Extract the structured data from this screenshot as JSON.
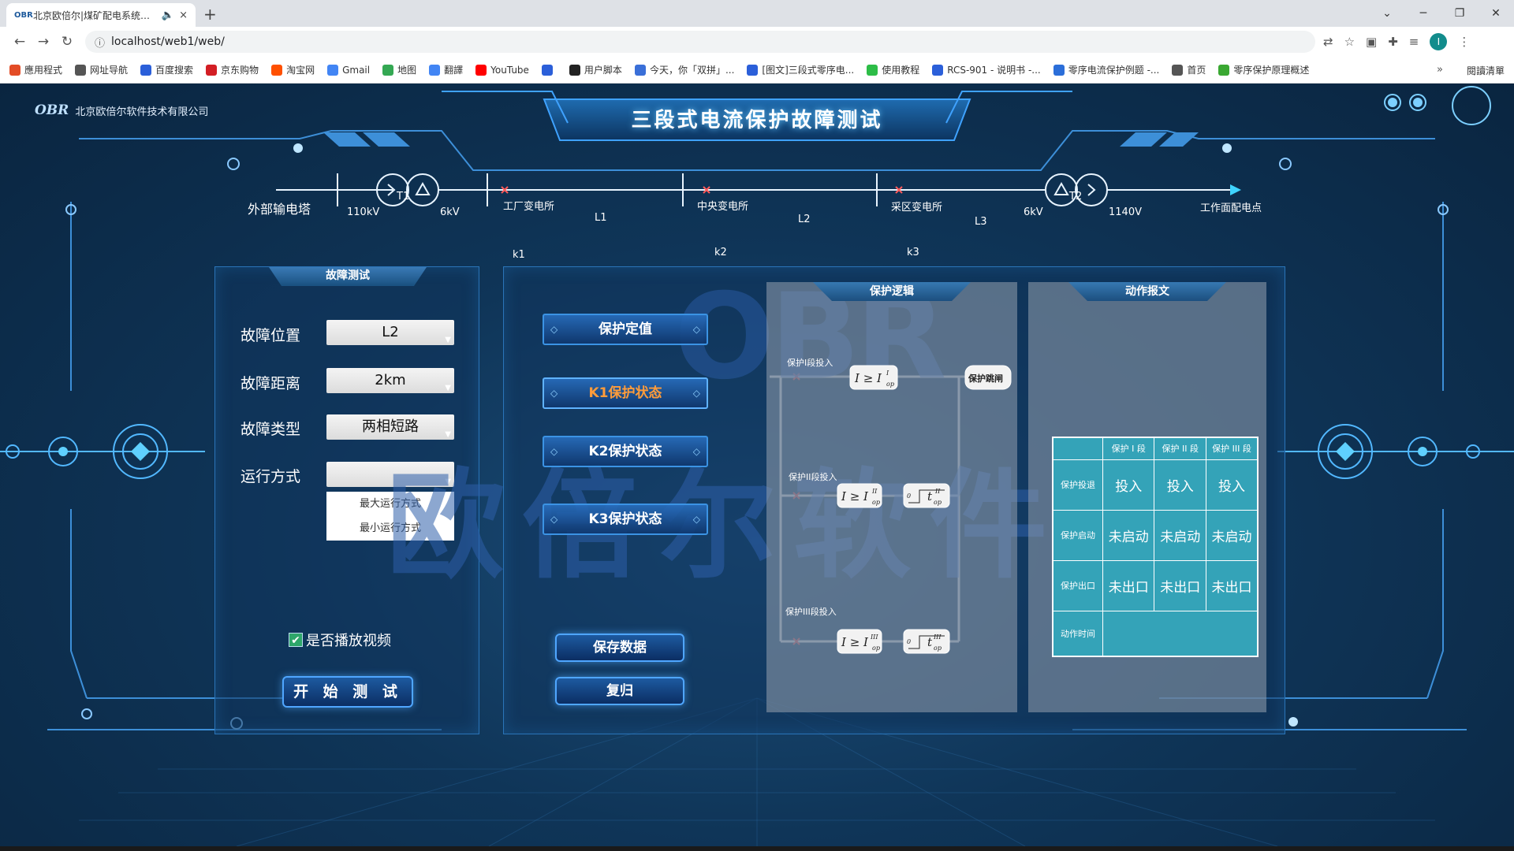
{
  "browser": {
    "tab_title": "北京欧倍尔|煤矿配电系统故障",
    "tab_fav": "OBR",
    "speaker_icon": "🔈",
    "close_tab": "×",
    "new_tab": "+",
    "url": "localhost/web1/web/",
    "bookmarks": [
      {
        "label": "應用程式",
        "color": "#e34c26"
      },
      {
        "label": "网址导航",
        "color": "#555555"
      },
      {
        "label": "百度搜索",
        "color": "#2b5fd9"
      },
      {
        "label": "京东购物",
        "color": "#d31e24"
      },
      {
        "label": "淘宝网",
        "color": "#ff5000"
      },
      {
        "label": "Gmail",
        "color": "#4285f4"
      },
      {
        "label": "地图",
        "color": "#34a853"
      },
      {
        "label": "翻譯",
        "color": "#4285f4"
      },
      {
        "label": "YouTube",
        "color": "#ff0000"
      },
      {
        "label": "",
        "color": "#2b5fd9"
      },
      {
        "label": "用户脚本",
        "color": "#222222"
      },
      {
        "label": "今天，你「双拼」...",
        "color": "#3a6fd8"
      },
      {
        "label": "[图文]三段式零序电...",
        "color": "#2b5fd9"
      },
      {
        "label": "使用教程",
        "color": "#2dbd47"
      },
      {
        "label": "RCS-901 - 说明书 -...",
        "color": "#2b5fd9"
      },
      {
        "label": "零序电流保护例题 -...",
        "color": "#2b6ed9"
      },
      {
        "label": "首页",
        "color": "#555555"
      },
      {
        "label": "零序保护原理概述",
        "color": "#3aa832"
      }
    ],
    "more": "»",
    "reading_list": "閱讀清單"
  },
  "app": {
    "logo_mark": "OBR",
    "company": "北京欧倍尔软件技术有限公司",
    "title": "三段式电流保护故障测试"
  },
  "diagram": {
    "source": "外部输电塔",
    "v110": "110kV",
    "t1": "T1",
    "v6a": "6kV",
    "factory": "工厂变电所",
    "l1": "L1",
    "k1": "k1",
    "central": "中央变电所",
    "l2": "L2",
    "k2": "k2",
    "mining": "采区变电所",
    "l3": "L3",
    "k3": "k3",
    "v6b": "6kV",
    "t2": "T2",
    "v1140": "1140V",
    "face": "工作面配电点"
  },
  "watermark": {
    "brand": "OBR",
    "cn": "欧倍尔软件"
  },
  "fault_panel": {
    "title": "故障测试",
    "location_label": "故障位置",
    "location_value": "L2",
    "distance_label": "故障距离",
    "distance_value": "2km",
    "type_label": "故障类型",
    "type_value": "两相短路",
    "mode_label": "运行方式",
    "mode_value": "",
    "mode_options": [
      "最大运行方式",
      "最小运行方式"
    ],
    "video_label": "是否播放视频",
    "video_checked": true,
    "start": "开 始 测 试"
  },
  "protection_buttons": {
    "setting": "保护定值",
    "k1": "K1保护状态",
    "k2": "K2保护状态",
    "k3": "K3保护状态",
    "save": "保存数据",
    "reset": "复归",
    "active_color": "#ff9c3a"
  },
  "logic": {
    "title": "保护逻辑",
    "stage1": "保护I段投入",
    "stage2": "保护II段投入",
    "stage3": "保护III段投入",
    "trip": "保护跳闸",
    "cmp1": "I ≥ I",
    "cmp2": "I ≥ I",
    "cmp3": "I ≥ I",
    "t_label": "t",
    "zero": "0",
    "sub_op": "op",
    "sup1": "I",
    "sup2": "II",
    "sup3": "III"
  },
  "report": {
    "title": "动作报文",
    "headers": [
      "",
      "保护 I 段",
      "保护 II 段",
      "保护 III 段"
    ],
    "rows": [
      {
        "label": "保护投退",
        "values": [
          "投入",
          "投入",
          "投入"
        ]
      },
      {
        "label": "保护启动",
        "values": [
          "未启动",
          "未启动",
          "未启动"
        ]
      },
      {
        "label": "保护出口",
        "values": [
          "未出口",
          "未出口",
          "未出口"
        ]
      },
      {
        "label": "动作时间",
        "values": [
          "",
          "",
          ""
        ]
      }
    ]
  }
}
